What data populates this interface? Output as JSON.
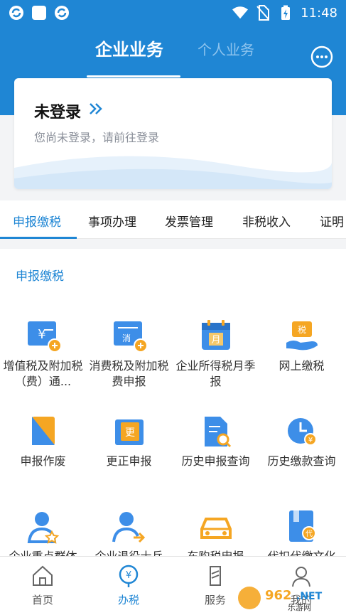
{
  "status": {
    "time": "11:48"
  },
  "header": {
    "tabs": [
      {
        "label": "企业业务",
        "active": true
      },
      {
        "label": "个人业务",
        "active": false
      }
    ]
  },
  "login": {
    "title": "未登录",
    "subtitle": "您尚未登录，请前往登录"
  },
  "categories": [
    {
      "label": "申报缴税",
      "active": true
    },
    {
      "label": "事项办理"
    },
    {
      "label": "发票管理"
    },
    {
      "label": "非税收入"
    },
    {
      "label": "证明"
    }
  ],
  "section": {
    "title": "申报缴税",
    "items": [
      {
        "label": "增值税及附加税（费）通...",
        "icon": "vat-icon"
      },
      {
        "label": "消费税及附加税费申报",
        "icon": "consumption-tax-icon"
      },
      {
        "label": "企业所得税月季报",
        "icon": "calendar-month-icon"
      },
      {
        "label": "网上缴税",
        "icon": "online-pay-icon"
      },
      {
        "label": "申报作废",
        "icon": "void-declaration-icon"
      },
      {
        "label": "更正申报",
        "icon": "correct-declaration-icon"
      },
      {
        "label": "历史申报查询",
        "icon": "history-search-icon"
      },
      {
        "label": "历史缴款查询",
        "icon": "history-payment-icon"
      },
      {
        "label": "企业重点群体",
        "icon": "key-group-icon"
      },
      {
        "label": "企业退役士兵",
        "icon": "veteran-icon"
      },
      {
        "label": "车购税申报",
        "icon": "car-icon"
      },
      {
        "label": "代扣代缴文化",
        "icon": "withhold-icon"
      }
    ]
  },
  "tabbar": [
    {
      "label": "首页",
      "icon": "home-icon",
      "active": false
    },
    {
      "label": "办税",
      "icon": "tax-icon",
      "active": true
    },
    {
      "label": "服务",
      "icon": "service-icon",
      "active": false
    },
    {
      "label": "我的",
      "icon": "profile-icon",
      "active": false
    }
  ],
  "watermark": {
    "text": "962.NET 乐游网"
  },
  "colors": {
    "primary": "#1f86d4",
    "accent_orange": "#f5a623"
  }
}
